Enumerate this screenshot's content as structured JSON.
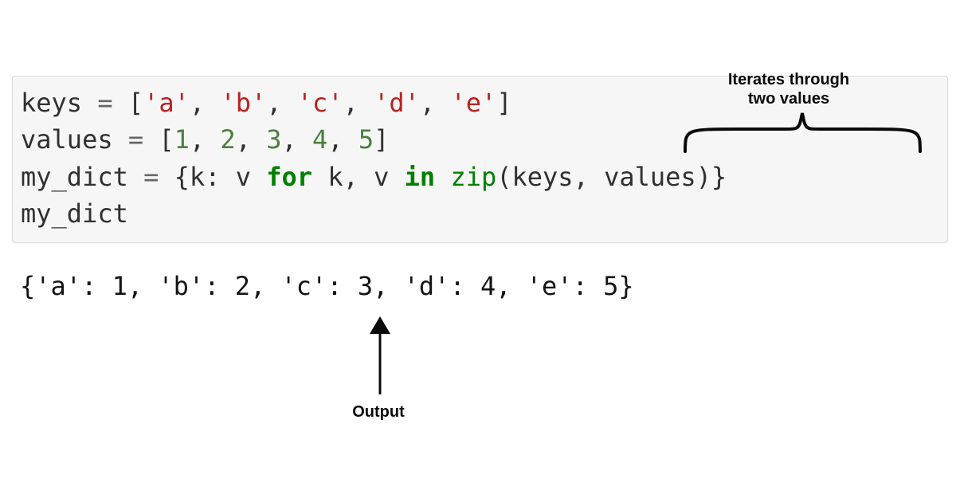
{
  "annotations": {
    "iterates": "Iterates through\ntwo values",
    "output": "Output"
  },
  "code": {
    "line1": {
      "var": "keys",
      "eq": " = ",
      "lb": "[",
      "s0": "'a'",
      "c0": ", ",
      "s1": "'b'",
      "c1": ", ",
      "s2": "'c'",
      "c2": ", ",
      "s3": "'d'",
      "c3": ", ",
      "s4": "'e'",
      "rb": "]"
    },
    "line2": {
      "var": "values",
      "eq": " = ",
      "lb": "[",
      "n0": "1",
      "c0": ", ",
      "n1": "2",
      "c1": ", ",
      "n2": "3",
      "c2": ", ",
      "n3": "4",
      "c3": ", ",
      "n4": "5",
      "rb": "]"
    },
    "line3": {
      "var": "my_dict",
      "eq": " = ",
      "lb": "{",
      "k": "k",
      "colon": ": ",
      "v": "v",
      "sp1": " ",
      "for": "for",
      "sp2": " ",
      "k2": "k",
      "comma": ", ",
      "v2": "v",
      "sp3": " ",
      "in": "in",
      "sp4": " ",
      "zip": "zip",
      "lp": "(",
      "keys": "keys",
      "comma2": ", ",
      "values": "values",
      "rp": ")",
      "rb": "}"
    },
    "line4": {
      "var": "my_dict"
    }
  },
  "output": {
    "content": "{'a': 1, 'b': 2, 'c': 3, 'd': 4, 'e': 5}"
  }
}
